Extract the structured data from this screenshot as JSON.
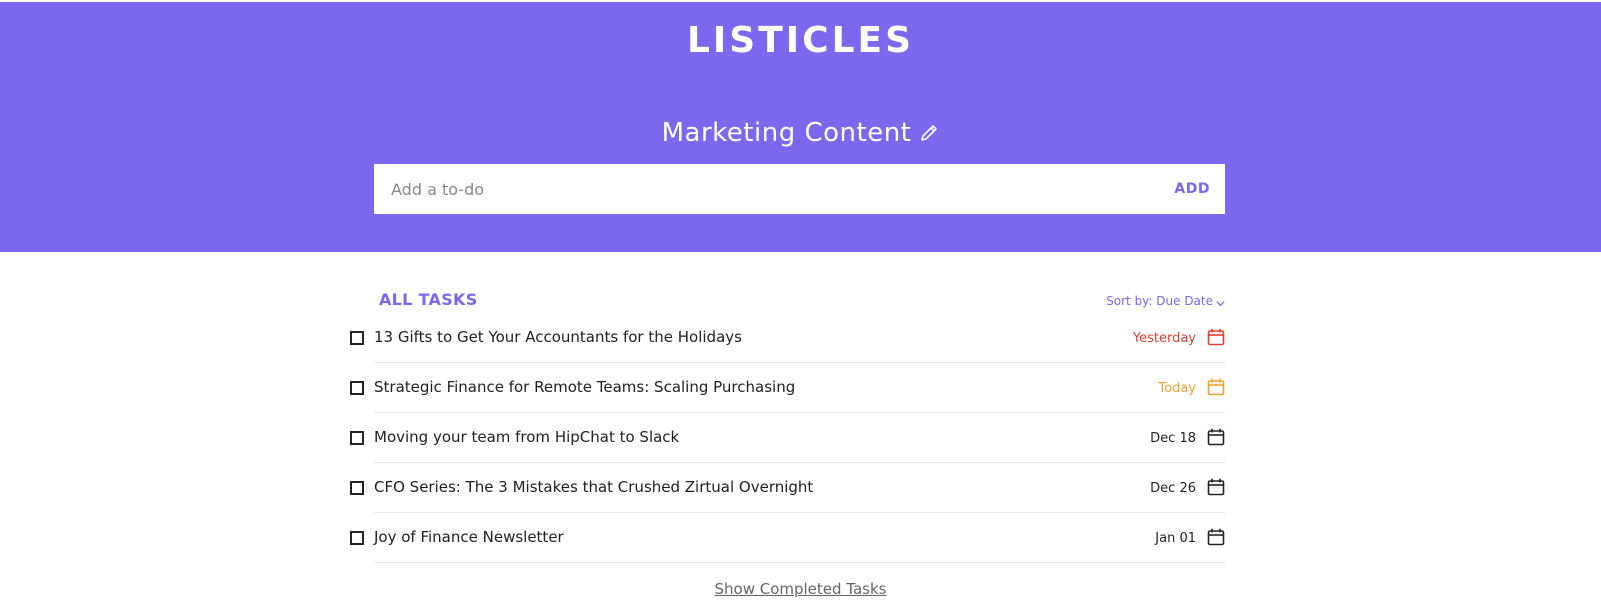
{
  "app": {
    "title": "LISTICLES"
  },
  "list": {
    "name": "Marketing Content",
    "edit_icon": "pencil-icon"
  },
  "add_bar": {
    "placeholder": "Add a to-do",
    "value": "",
    "add_label": "ADD"
  },
  "list_header": {
    "label": "ALL TASKS",
    "sort_label": "Sort by: Due Date",
    "sort_icon": "chevron-down-icon"
  },
  "tasks": [
    {
      "title": "13 Gifts to Get Your Accountants for the Holidays",
      "due": "Yesterday",
      "status": "overdue",
      "checked": false
    },
    {
      "title": "Strategic Finance for Remote Teams: Scaling Purchasing",
      "due": "Today",
      "status": "today",
      "checked": false
    },
    {
      "title": "Moving your team from HipChat to Slack",
      "due": "Dec 18",
      "status": "upcoming",
      "checked": false
    },
    {
      "title": "CFO Series: The 3 Mistakes that Crushed Zirtual Overnight",
      "due": "Dec 26",
      "status": "upcoming",
      "checked": false
    },
    {
      "title": "Joy of Finance Newsletter",
      "due": "Jan 01",
      "status": "upcoming",
      "checked": false
    }
  ],
  "footer": {
    "show_completed_label": "Show Completed Tasks"
  },
  "colors": {
    "accent": "#7b68ee",
    "overdue": "#e03c31",
    "today": "#f0a030",
    "upcoming": "#222222",
    "divider": "#e6e6e6"
  }
}
